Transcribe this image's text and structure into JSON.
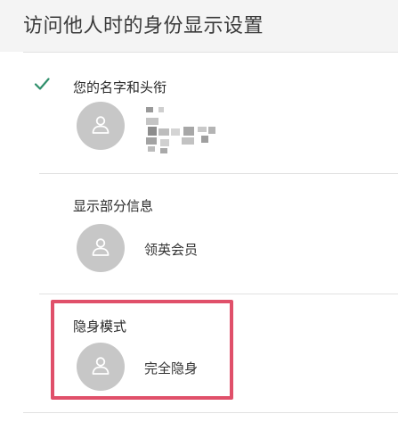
{
  "header": {
    "title": "访问他人时的身份显示设置"
  },
  "options": [
    {
      "label": "您的名字和头衔",
      "value": "",
      "selected": true,
      "value_redacted": true
    },
    {
      "label": "显示部分信息",
      "value": "领英会员",
      "selected": false
    },
    {
      "label": "隐身模式",
      "value": "完全隐身",
      "selected": false,
      "highlighted": true
    }
  ],
  "icons": {
    "check": "check-icon",
    "avatar": "person-icon"
  },
  "colors": {
    "check_green": "#2f8f6b",
    "highlight_pink": "#e0506a",
    "avatar_gray": "#c7c7c7"
  }
}
